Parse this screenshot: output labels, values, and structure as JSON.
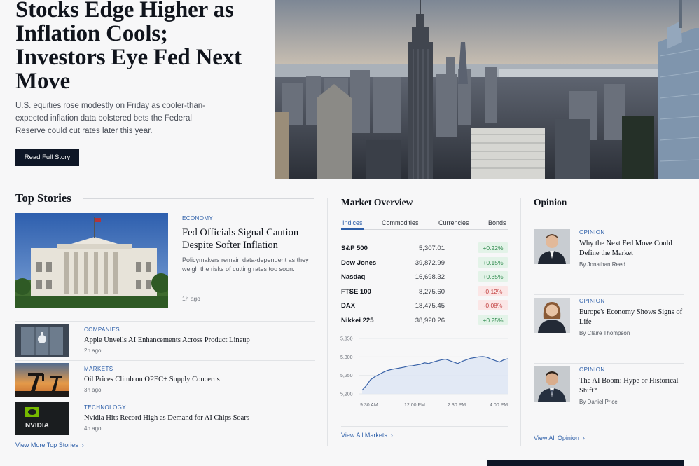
{
  "hero": {
    "title": "Stocks Edge Higher as Inflation Cools; Investors Eye Fed Next Move",
    "summary": "U.S. equities rose modestly on Friday as cooler-than-expected inflation data bolstered bets the Federal Reserve could cut rates later this year.",
    "button_label": "Read Full Story"
  },
  "top_stories": {
    "heading": "Top Stories",
    "featured": {
      "category": "ECONOMY",
      "title": "Fed Officials Signal Caution Despite Softer Inflation",
      "description": "Policymakers remain data-dependent as they weigh the risks of cutting rates too soon.",
      "time": "1h ago"
    },
    "items": [
      {
        "category": "COMPANIES",
        "title": "Apple Unveils AI Enhancements Across Product Lineup",
        "time": "2h ago",
        "thumb": "apple-store-icon"
      },
      {
        "category": "MARKETS",
        "title": "Oil Prices Climb on OPEC+ Supply Concerns",
        "time": "3h ago",
        "thumb": "oil-pump-icon"
      },
      {
        "category": "TECHNOLOGY",
        "title": "Nvidia Hits Record High as Demand for AI Chips Soars",
        "time": "4h ago",
        "thumb": "nvidia-logo-icon"
      }
    ],
    "more_link": "View More Top Stories"
  },
  "market": {
    "heading": "Market Overview",
    "tabs": [
      "Indices",
      "Commodities",
      "Currencies",
      "Bonds"
    ],
    "active_tab": "Indices",
    "rows": [
      {
        "name": "S&P 500",
        "value": "5,307.01",
        "change": "+0.22%",
        "dir": "up"
      },
      {
        "name": "Dow Jones",
        "value": "39,872.99",
        "change": "+0.15%",
        "dir": "up"
      },
      {
        "name": "Nasdaq",
        "value": "16,698.32",
        "change": "+0.35%",
        "dir": "up"
      },
      {
        "name": "FTSE 100",
        "value": "8,275.60",
        "change": "-0.12%",
        "dir": "down"
      },
      {
        "name": "DAX",
        "value": "18,475.45",
        "change": "-0.08%",
        "dir": "down"
      },
      {
        "name": "Nikkei 225",
        "value": "38,920.26",
        "change": "+0.25%",
        "dir": "up"
      }
    ],
    "more_link": "View All Markets",
    "colors": {
      "up": "#2f8a4d",
      "down": "#c24141",
      "accent": "#2c5ea8"
    }
  },
  "chart_data": {
    "type": "area",
    "title": "",
    "x_ticks": [
      "9:30 AM",
      "12:00 PM",
      "2:30 PM",
      "4:00 PM"
    ],
    "y_ticks": [
      "5,350",
      "5,300",
      "5,250",
      "5,200"
    ],
    "ylim": [
      5200,
      5350
    ],
    "values": [
      5210,
      5222,
      5238,
      5246,
      5252,
      5258,
      5263,
      5266,
      5268,
      5270,
      5272,
      5275,
      5276,
      5278,
      5280,
      5284,
      5282,
      5286,
      5289,
      5292,
      5294,
      5290,
      5286,
      5282,
      5288,
      5292,
      5296,
      5298,
      5300,
      5301,
      5299,
      5294,
      5290,
      5286,
      5292,
      5295
    ],
    "grid": true
  },
  "opinion": {
    "heading": "Opinion",
    "items": [
      {
        "category": "OPINION",
        "title": "Why the Next Fed Move Could Define the Market",
        "byline": "By Jonathan Reed"
      },
      {
        "category": "OPINION",
        "title": "Europe's Economy Shows Signs of Life",
        "byline": "By Claire Thompson"
      },
      {
        "category": "OPINION",
        "title": "The AI Boom: Hype or Historical Shift?",
        "byline": "By Daniel Price"
      }
    ],
    "more_link": "View All Opinion"
  }
}
